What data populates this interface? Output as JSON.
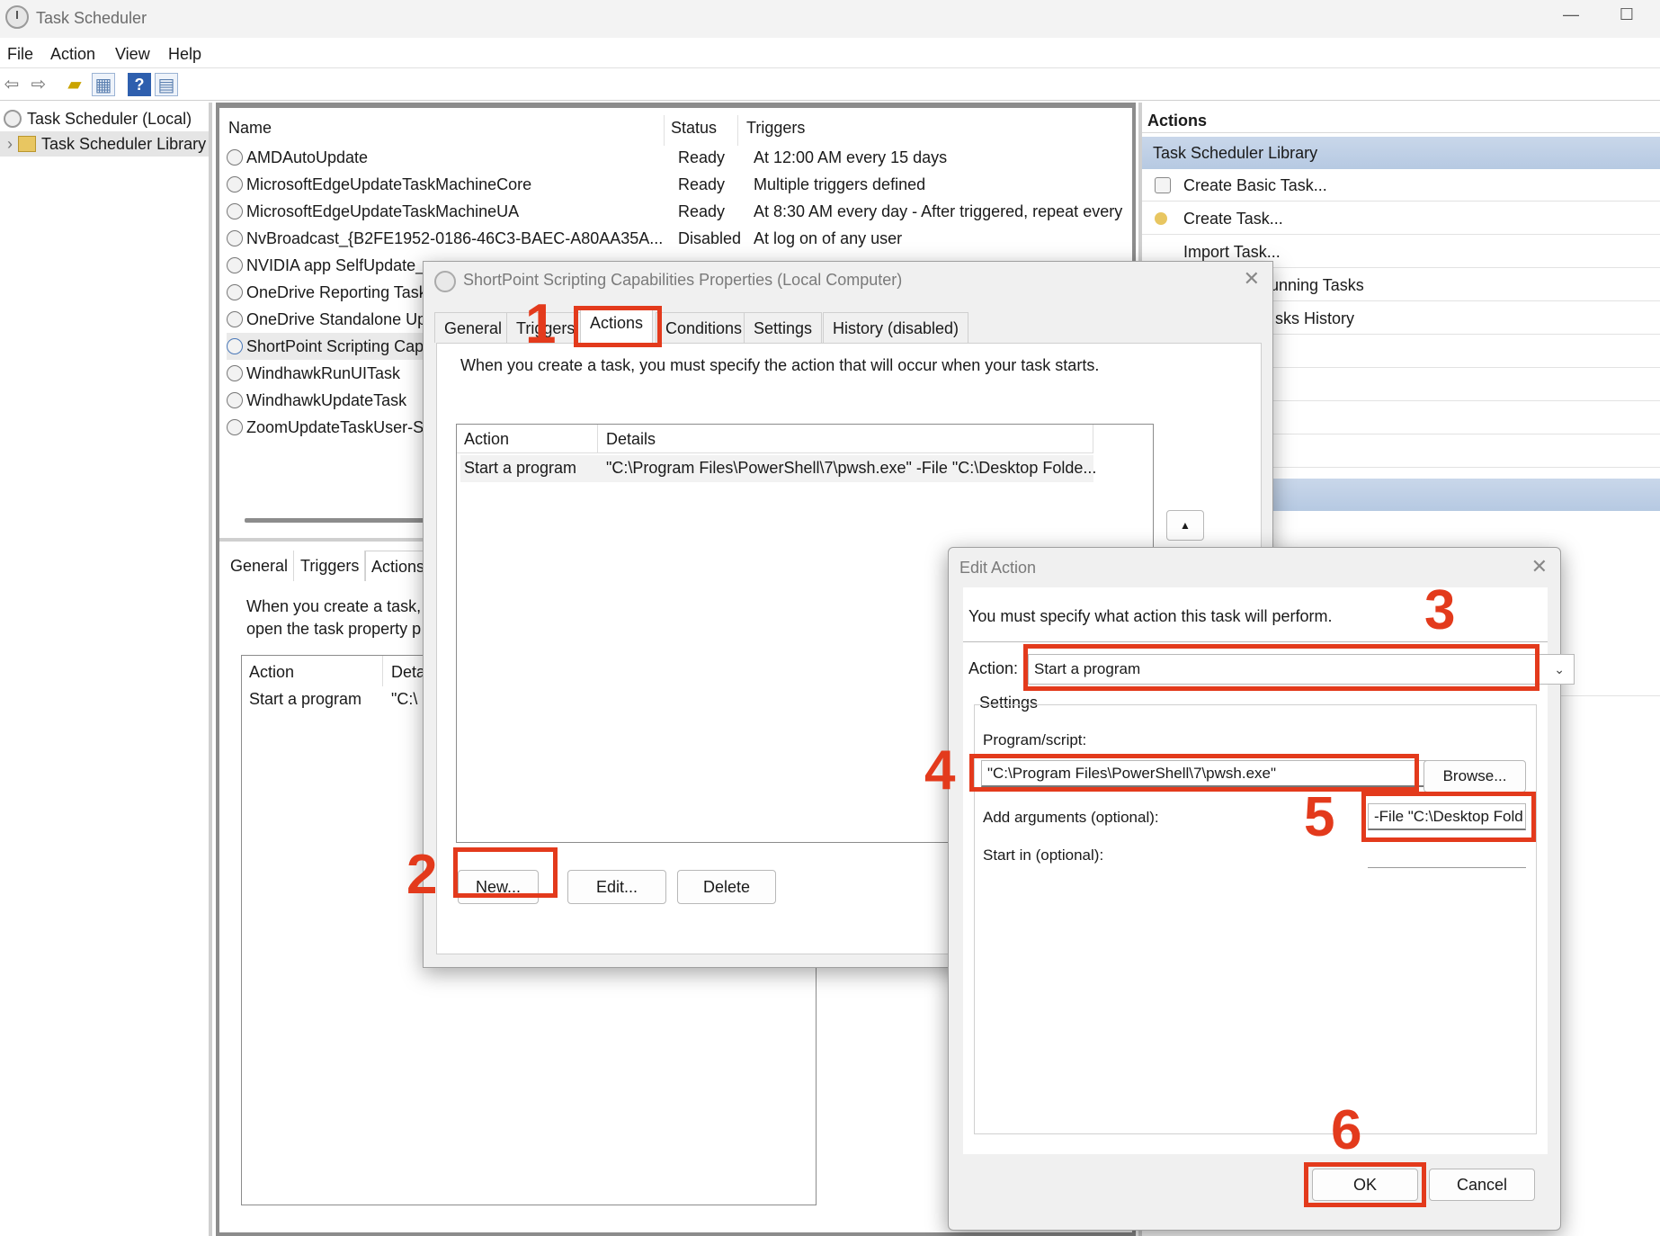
{
  "window": {
    "title": "Task Scheduler"
  },
  "menu": [
    "File",
    "Action",
    "View",
    "Help"
  ],
  "toolbar_icons": [
    "back-arrow-icon",
    "forward-arrow-icon",
    "folder-up-icon",
    "view-icon",
    "help-icon",
    "panel-icon"
  ],
  "tree": {
    "root": "Task Scheduler (Local)",
    "library": "Task Scheduler Library"
  },
  "task_list": {
    "columns": [
      "Name",
      "Status",
      "Triggers"
    ],
    "rows": [
      {
        "name": "AMDAutoUpdate",
        "status": "Ready",
        "trigger": "At 12:00 AM every 15 days"
      },
      {
        "name": "MicrosoftEdgeUpdateTaskMachineCore",
        "status": "Ready",
        "trigger": "Multiple triggers defined"
      },
      {
        "name": "MicrosoftEdgeUpdateTaskMachineUA",
        "status": "Ready",
        "trigger": "At 8:30 AM every day - After triggered, repeat every"
      },
      {
        "name": "NvBroadcast_{B2FE1952-0186-46C3-BAEC-A80AA35A...",
        "status": "Disabled",
        "trigger": "At log on of any user"
      },
      {
        "name": "NVIDIA app SelfUpdate_",
        "status": "",
        "trigger": ""
      },
      {
        "name": "OneDrive Reporting Task",
        "status": "",
        "trigger": ""
      },
      {
        "name": "OneDrive Standalone Up",
        "status": "",
        "trigger": ""
      },
      {
        "name": "ShortPoint Scripting Cap",
        "status": "",
        "trigger": ""
      },
      {
        "name": "WindhawkRunUITask",
        "status": "",
        "trigger": ""
      },
      {
        "name": "WindhawkUpdateTask",
        "status": "",
        "trigger": ""
      },
      {
        "name": "ZoomUpdateTaskUser-S",
        "status": "",
        "trigger": ""
      }
    ]
  },
  "bottom_pane": {
    "tabs": [
      "General",
      "Triggers",
      "Actions"
    ],
    "desc_line1": "When you create a task,",
    "desc_line2": "open the task property p",
    "col_action": "Action",
    "col_details": "Deta",
    "row_action": "Start a program",
    "row_details": "\"C:\\"
  },
  "actions_pane": {
    "header": "Actions",
    "section": "Task Scheduler Library",
    "items": [
      "Create Basic Task...",
      "Create Task...",
      "Import Task...",
      "unning Tasks",
      "sks History"
    ]
  },
  "properties_dialog": {
    "title": "ShortPoint Scripting Capabilities Properties (Local Computer)",
    "tabs": [
      "General",
      "Triggers",
      "Actions",
      "Conditions",
      "Settings",
      "History (disabled)"
    ],
    "description": "When you create a task, you must specify the action that will occur when your task starts.",
    "list_columns": [
      "Action",
      "Details"
    ],
    "list_row": {
      "action": "Start a program",
      "details": "\"C:\\Program Files\\PowerShell\\7\\pwsh.exe\" -File \"C:\\Desktop Folde..."
    },
    "buttons": {
      "new": "New...",
      "edit": "Edit...",
      "delete": "Delete"
    },
    "up_arrow": "▲"
  },
  "edit_action_dialog": {
    "title": "Edit Action",
    "prompt": "You must specify what action this task will perform.",
    "action_label": "Action:",
    "action_value": "Start a program",
    "settings_label": "Settings",
    "program_label": "Program/script:",
    "program_value": "\"C:\\Program Files\\PowerShell\\7\\pwsh.exe\"",
    "browse": "Browse...",
    "arguments_label": "Add arguments (optional):",
    "arguments_value": "-File \"C:\\Desktop Fold",
    "start_in_label": "Start in (optional):",
    "start_in_value": "",
    "ok": "OK",
    "cancel": "Cancel"
  },
  "annotations": [
    "1",
    "2",
    "3",
    "4",
    "5",
    "6"
  ],
  "colors": {
    "highlight": "#e33a1c",
    "selection": "#b6c9e2"
  }
}
